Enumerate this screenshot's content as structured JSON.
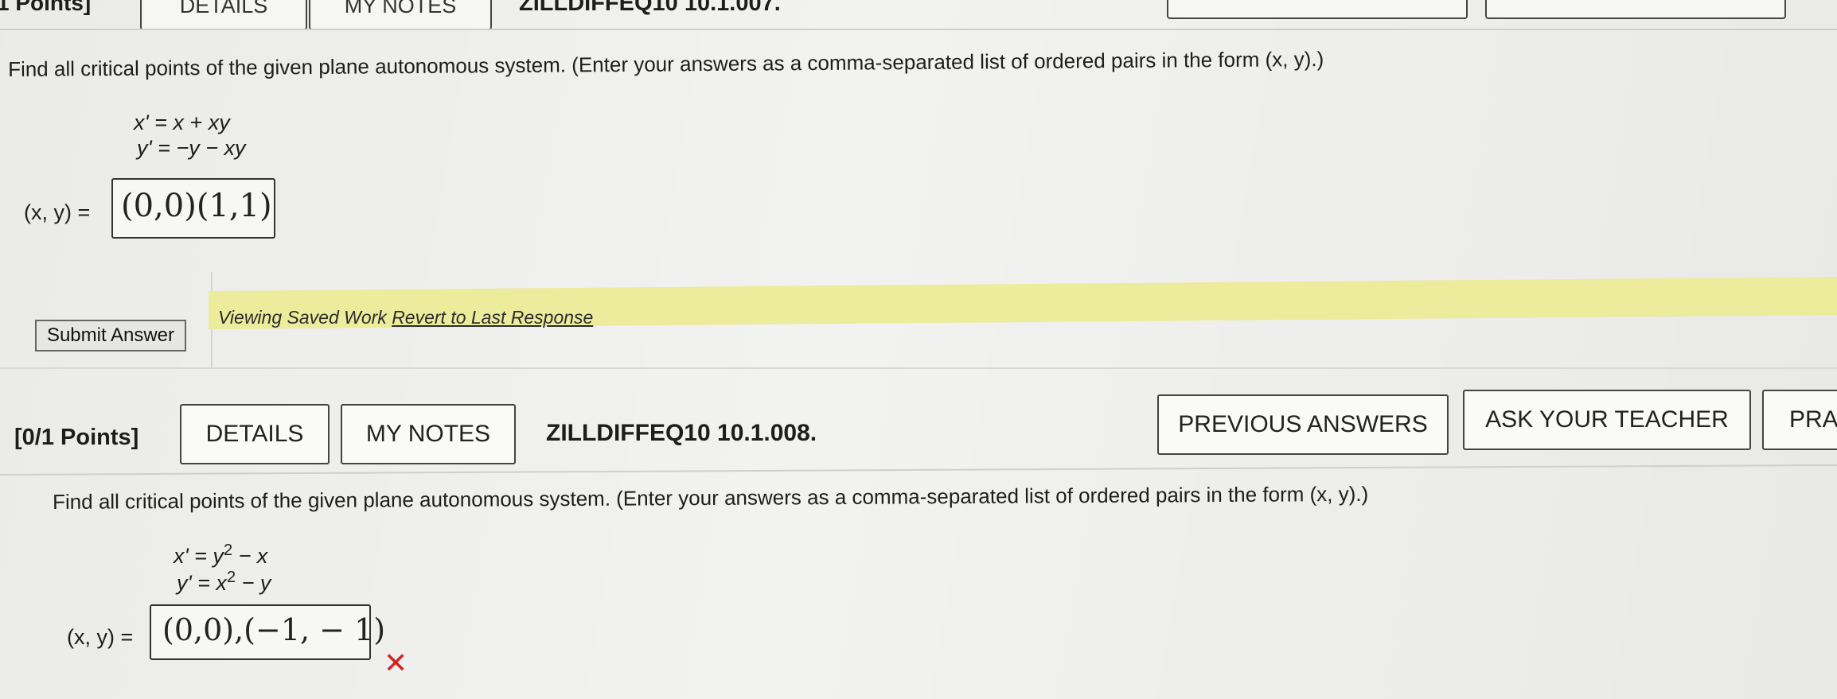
{
  "top_bar": {
    "points": "1 Points]",
    "details": "DETAILS",
    "my_notes": "MY NOTES",
    "code": "ZILLDIFFEQ10 10.1.007."
  },
  "problem1": {
    "question": "Find all critical points of the given plane autonomous system. (Enter your answers as a comma-separated list of ordered pairs in the form (x, y).)",
    "eq1": "x' = x + xy",
    "eq2": "y' = −y − xy",
    "answer_label": "(x, y) =",
    "answer_value": "(0,0)(1,1)",
    "submit_label": "Submit Answer",
    "saved_text": "Viewing Saved Work",
    "revert_link": "Revert to Last Response"
  },
  "problem2": {
    "points": "[0/1 Points]",
    "details": "DETAILS",
    "my_notes": "MY NOTES",
    "code": "ZILLDIFFEQ10 10.1.008.",
    "previous_answers": "PREVIOUS ANSWERS",
    "ask_teacher": "ASK YOUR TEACHER",
    "practice": "PRA",
    "question": "Find all critical points of the given plane autonomous system. (Enter your answers as a comma-separated list of ordered pairs in the form (x, y).)",
    "eq1_a": "x' = y",
    "eq1_exp": "2",
    "eq1_b": " − x",
    "eq2_a": "y' = x",
    "eq2_exp": "2",
    "eq2_b": " − y",
    "answer_label": "(x, y) =",
    "answer_value": "(0,0),(−1, − 1)",
    "status_icon": "x-mark-icon",
    "status_color": "#d22222"
  }
}
